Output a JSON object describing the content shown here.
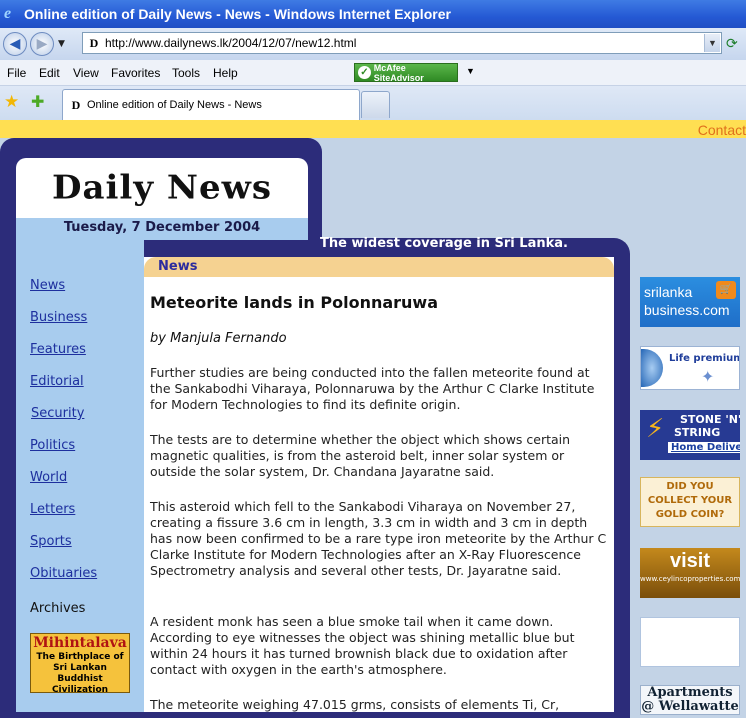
{
  "window": {
    "title": "Online edition of Daily News - News - Windows Internet Explorer"
  },
  "address": {
    "url": "http://www.dailynews.lk/2004/12/07/new12.html"
  },
  "menu": {
    "items": [
      "File",
      "Edit",
      "View",
      "Favorites",
      "Tools",
      "Help"
    ]
  },
  "mcafee": {
    "label": "McAfee SiteAdvisor"
  },
  "tabs": [
    {
      "label": "Online edition of Daily News - News"
    }
  ],
  "page": {
    "contact": "Contact",
    "logo": "Daily News",
    "date": "Tuesday, 7 December 2004",
    "tagline": "The widest coverage in Sri Lanka.",
    "section": "News",
    "nav": [
      "News",
      "Business",
      "Features",
      "Editorial",
      "Security",
      "Politics",
      "World",
      "Letters",
      "Sports",
      "Obituaries"
    ],
    "archives": "Archives",
    "mihintalava": {
      "title": "Mihintalava",
      "sub": "The Birthplace of Sri Lankan Buddhist Civilization"
    },
    "article": {
      "title": "Meteorite lands in Polonnaruwa",
      "byline": "by Manjula Fernando",
      "paragraphs": [
        "Further studies are being conducted into the fallen meteorite found at the Sankabodhi Viharaya, Polonnaruwa by the Arthur C Clarke Institute for Modern Technologies to find its definite origin.",
        "The tests are to determine whether the object which shows certain magnetic qualities, is from the asteroid belt, inner solar system or outside the solar system, Dr. Chandana Jayaratne said.",
        "This asteroid which fell to the Sankabodi Viharaya on November 27, creating a fissure 3.6 cm in length, 3.3 cm in width and 3 cm in depth has now been confirmed to be a rare type iron meteorite by the Arthur C Clarke Institute for Modern Technologies after an X-Ray Fluorescence Spectrometry analysis and several other tests, Dr. Jayaratne said.",
        "A resident monk has seen a blue smoke tail when it came down. According to eye witnesses the object was shining metallic blue but within 24 hours it has turned brownish black due to oxidation after contact with oxygen in the earth's atmosphere.",
        "The meteorite weighing 47.015 grms, consists of elements Ti, Cr,"
      ]
    },
    "ads": {
      "srilanka_business": "srilanka business.com",
      "life_premium": "Life premium",
      "stone_n_string": [
        "STONE 'N'",
        "STRING"
      ],
      "home_delivery": "Home Delivery",
      "gold_coin": "DID YOU COLLECT YOUR GOLD COIN?",
      "visit": "visit",
      "visit_url": "www.ceylincoproperties.com",
      "apartments": "Apartments @ Wellawatte"
    }
  }
}
